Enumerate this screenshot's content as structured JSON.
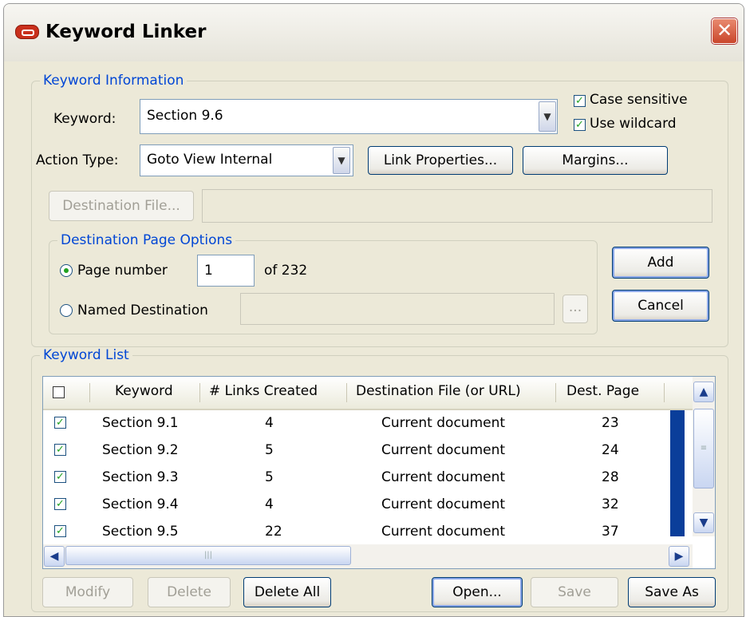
{
  "window": {
    "title": "Keyword Linker",
    "close_glyph": "✕"
  },
  "keyword_info": {
    "legend": "Keyword Information",
    "keyword_label": "Keyword:",
    "keyword_value": "Section 9.6",
    "case_sensitive": {
      "label": "Case sensitive",
      "checked": true
    },
    "use_wildcard": {
      "label": "Use wildcard",
      "checked": true
    },
    "action_type_label": "Action Type:",
    "action_type_value": "Goto View Internal",
    "link_properties_button": "Link Properties...",
    "margins_button": "Margins...",
    "destination_file_button": "Destination File...",
    "destination_file_value": ""
  },
  "page_options": {
    "legend": "Destination Page Options",
    "page_number_label": "Page number",
    "page_number_value": "1",
    "page_of": "of 232",
    "named_destination_label": "Named Destination",
    "browse_button": "...",
    "selected": "page_number"
  },
  "actions": {
    "add": "Add",
    "cancel": "Cancel"
  },
  "keyword_list": {
    "legend": "Keyword List",
    "columns": [
      "Keyword",
      "# Links Created",
      "Destination File (or URL)",
      "Dest. Page"
    ],
    "rows": [
      {
        "keyword": "Section 9.1",
        "links": "4",
        "file": "Current document",
        "page": "23",
        "checked": true
      },
      {
        "keyword": "Section 9.2",
        "links": "5",
        "file": "Current document",
        "page": "24",
        "checked": true
      },
      {
        "keyword": "Section 9.3",
        "links": "5",
        "file": "Current document",
        "page": "28",
        "checked": true
      },
      {
        "keyword": "Section 9.4",
        "links": "4",
        "file": "Current document",
        "page": "32",
        "checked": true
      },
      {
        "keyword": "Section 9.5",
        "links": "22",
        "file": "Current document",
        "page": "37",
        "checked": true
      }
    ]
  },
  "bottom_buttons": {
    "modify": "Modify",
    "delete": "Delete",
    "delete_all": "Delete All",
    "open": "Open...",
    "save": "Save",
    "save_as": "Save As"
  },
  "colors": {
    "accent": "#0046d5",
    "check": "#21a121",
    "window_bg": "#ece9d8",
    "selection": "#0a3e9a"
  }
}
